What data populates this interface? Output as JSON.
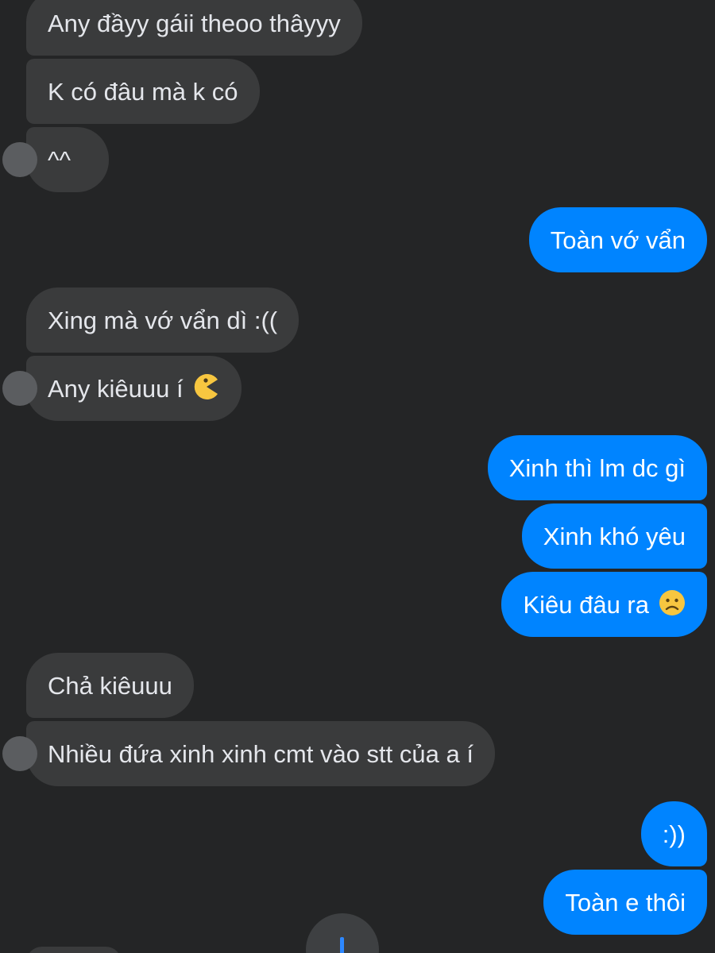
{
  "colors": {
    "background": "#242526",
    "incoming_bubble": "#3a3b3c",
    "outgoing_bubble": "#0084ff",
    "incoming_text": "#e4e6eb",
    "outgoing_text": "#ffffff"
  },
  "messages": [
    {
      "direction": "incoming",
      "text": "Any đầyy gáii theoo thâyyy"
    },
    {
      "direction": "incoming",
      "text": "K có đâu mà k có"
    },
    {
      "direction": "incoming",
      "text": "^^"
    },
    {
      "direction": "outgoing",
      "text": "Toàn vớ vẩn"
    },
    {
      "direction": "incoming",
      "text": "Xing mà vớ vẩn dì :(("
    },
    {
      "direction": "incoming",
      "text": "Any kiêuuu í",
      "emoji": "pacman-emoji"
    },
    {
      "direction": "outgoing",
      "text": "Xinh thì lm dc gì"
    },
    {
      "direction": "outgoing",
      "text": "Xinh khó yêu"
    },
    {
      "direction": "outgoing",
      "text": "Kiêu đâu ra",
      "emoji": "frowning-face-emoji"
    },
    {
      "direction": "incoming",
      "text": "Chả kiêuuu"
    },
    {
      "direction": "incoming",
      "text": "Nhiều đứa xinh xinh cmt vào stt của a í"
    },
    {
      "direction": "outgoing",
      "text": ":))"
    },
    {
      "direction": "outgoing",
      "text": "Toàn e thôi"
    }
  ],
  "icons": {
    "scroll_down": "arrow-down-icon"
  }
}
